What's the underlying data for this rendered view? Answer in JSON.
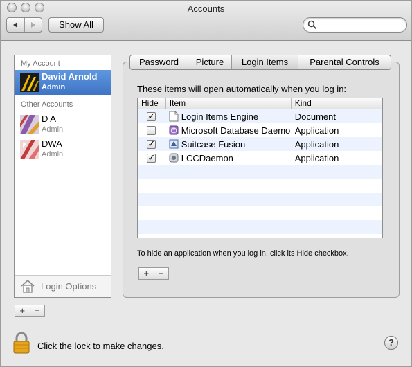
{
  "window": {
    "title": "Accounts"
  },
  "toolbar": {
    "back_icon": "back-arrow-icon",
    "forward_icon": "forward-arrow-icon",
    "show_all_label": "Show All",
    "search": {
      "value": "",
      "placeholder": "",
      "icon": "search-icon"
    }
  },
  "sidebar": {
    "my_account_header": "My Account",
    "selected_account": {
      "name": "David Arnold",
      "role": "Admin"
    },
    "other_accounts_header": "Other Accounts",
    "other_accounts": [
      {
        "name": "D A",
        "role": "Admin"
      },
      {
        "name": "DWA",
        "role": "Admin"
      }
    ],
    "login_options_label": "Login Options",
    "add_label": "+",
    "remove_label": "−"
  },
  "tabs": [
    {
      "label": "Password",
      "active": false
    },
    {
      "label": "Picture",
      "active": false
    },
    {
      "label": "Login Items",
      "active": true
    },
    {
      "label": "Parental Controls",
      "active": false
    }
  ],
  "login_items": {
    "description": "These items will open automatically when you log in:",
    "columns": {
      "hide": "Hide",
      "item": "Item",
      "kind": "Kind"
    },
    "rows": [
      {
        "hide": true,
        "item": "Login Items Engine",
        "kind": "Document",
        "icon": "document-icon"
      },
      {
        "hide": false,
        "item": "Microsoft Database Daemon",
        "kind": "Application",
        "icon": "database-daemon-icon"
      },
      {
        "hide": true,
        "item": "Suitcase Fusion",
        "kind": "Application",
        "icon": "suitcase-fusion-icon"
      },
      {
        "hide": true,
        "item": "LCCDaemon",
        "kind": "Application",
        "icon": "lccdaemon-icon"
      }
    ],
    "hint": "To hide an application when you log in, click its Hide checkbox.",
    "add_label": "+",
    "remove_label": "−"
  },
  "footer": {
    "lock_text": "Click the lock to make changes.",
    "help_label": "?"
  },
  "colors": {
    "selection": "#3f74c6",
    "alt_row": "#edf3fe"
  }
}
